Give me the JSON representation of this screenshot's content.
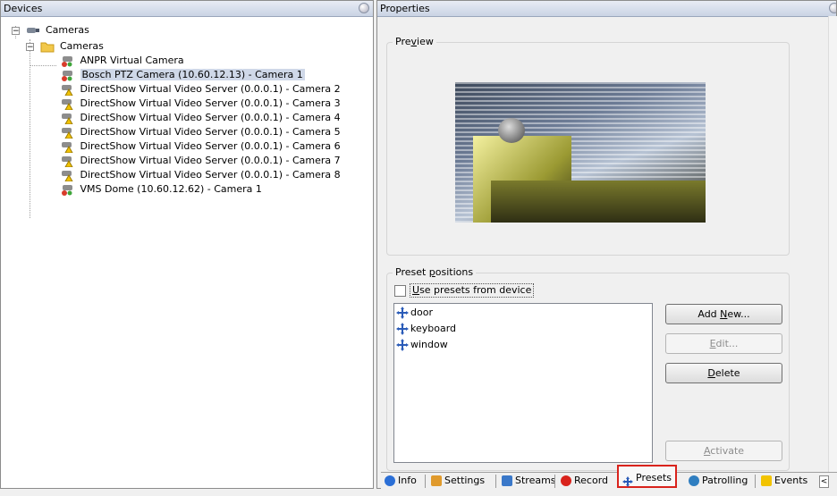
{
  "devices_pane": {
    "title": "Devices"
  },
  "properties_pane": {
    "title": "Properties"
  },
  "tree": {
    "root": "Cameras",
    "group": "Cameras",
    "items": [
      "ANPR Virtual Camera",
      "Bosch PTZ Camera (10.60.12.13) - Camera 1",
      "DirectShow Virtual Video Server (0.0.0.1) - Camera 2",
      "DirectShow Virtual Video Server (0.0.0.1) - Camera 3",
      "DirectShow Virtual Video Server (0.0.0.1) - Camera 4",
      "DirectShow Virtual Video Server (0.0.0.1) - Camera 5",
      "DirectShow Virtual Video Server (0.0.0.1) - Camera 6",
      "DirectShow Virtual Video Server (0.0.0.1) - Camera 7",
      "DirectShow Virtual Video Server (0.0.0.1) - Camera 8",
      "VMS Dome (10.60.12.62) - Camera 1"
    ],
    "selected_index": 1
  },
  "preview": {
    "title_pre": "Pre",
    "title_ul": "v",
    "title_post": "iew"
  },
  "presets": {
    "title_pre": "Preset ",
    "title_ul": "p",
    "title_post": "ositions",
    "use_device_ul": "U",
    "use_device_rest": "se presets from device",
    "items": [
      "door",
      "keyboard",
      "window"
    ],
    "buttons": {
      "add_new_pre": "Add ",
      "add_new_ul": "N",
      "add_new_post": "ew...",
      "edit_ul": "E",
      "edit_post": "dit...",
      "delete_ul": "D",
      "delete_post": "elete",
      "activate_ul": "A",
      "activate_post": "ctivate"
    }
  },
  "tabs": [
    "Info",
    "Settings",
    "Streams",
    "Record",
    "Presets",
    "Patrolling",
    "Events"
  ],
  "active_tab": "Presets",
  "colors": {
    "accent_red": "#d9231c",
    "selection": "#cfd8e8",
    "header": "#c9d3e4"
  }
}
